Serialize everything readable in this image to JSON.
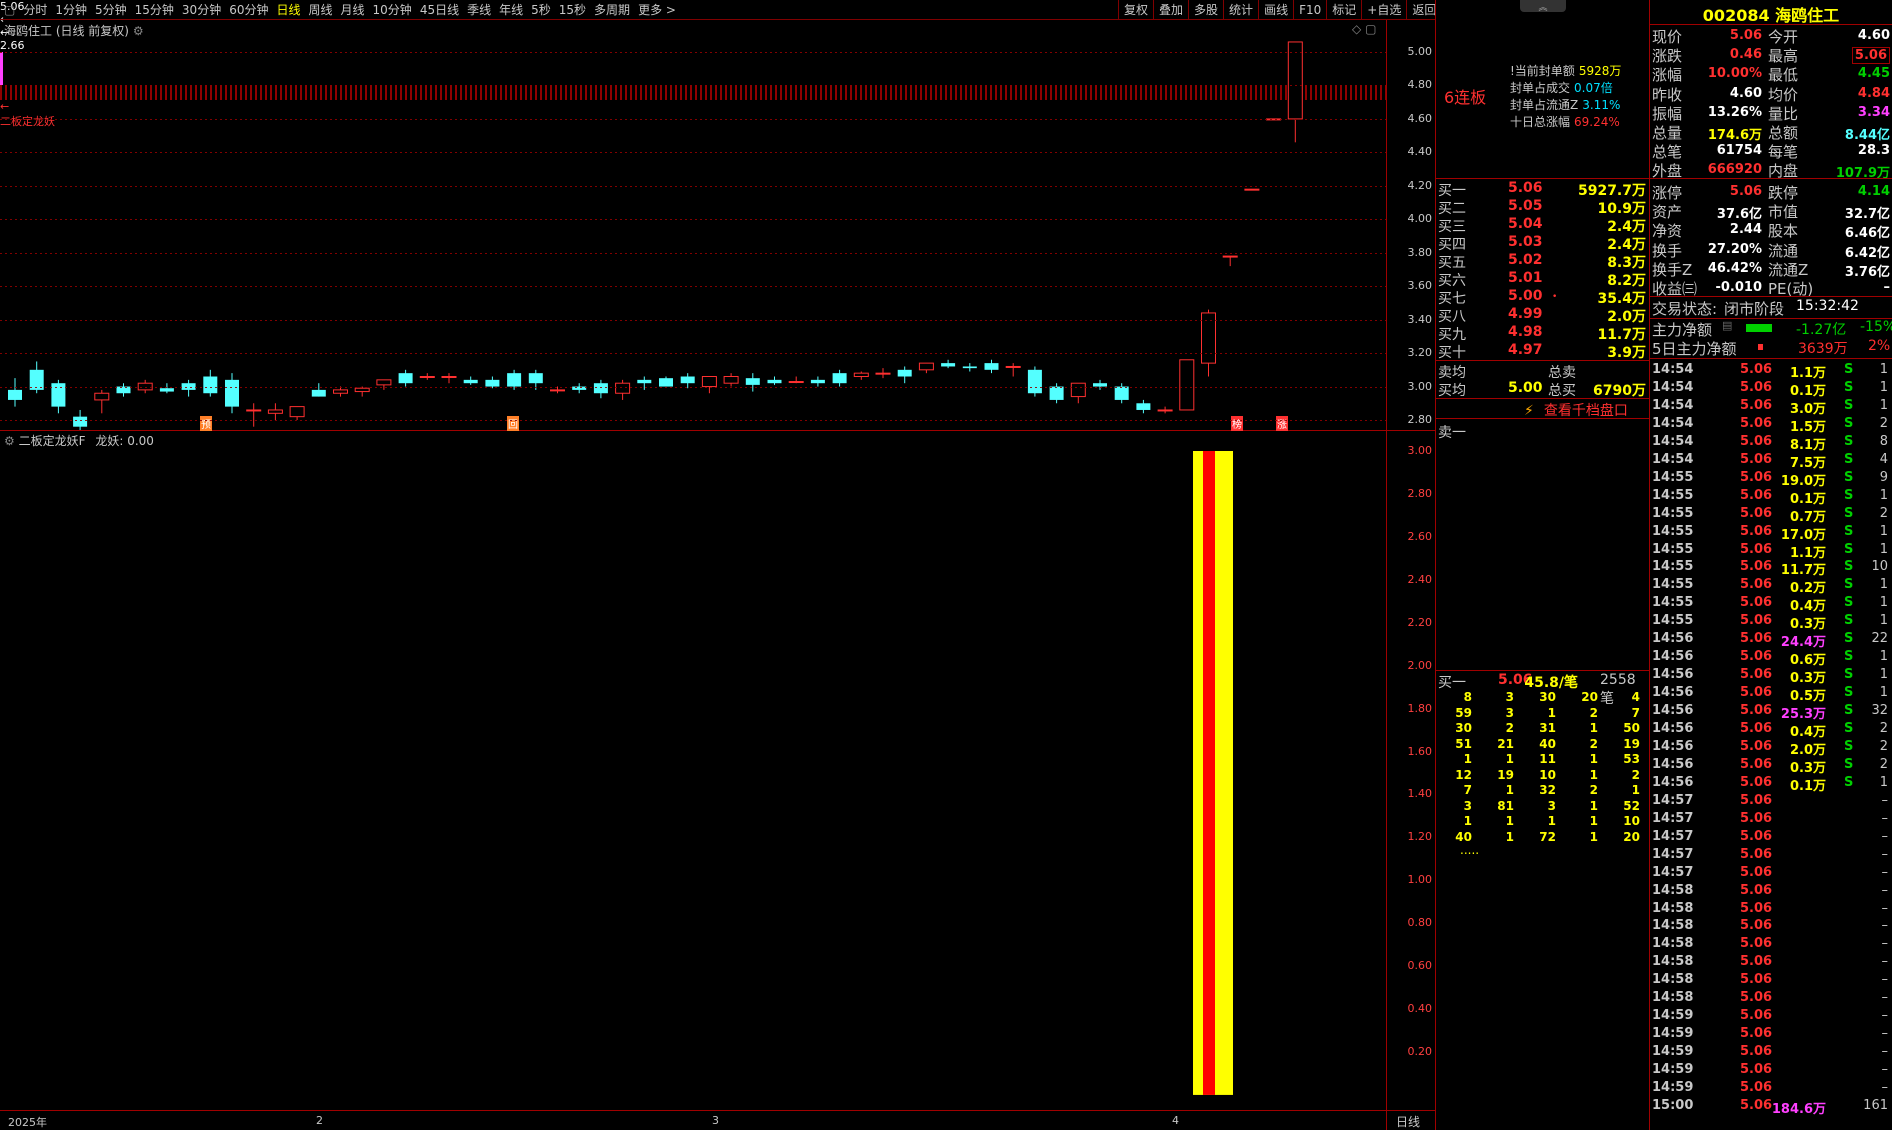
{
  "toolbar": {
    "left": [
      "分时",
      "1分钟",
      "5分钟",
      "15分钟",
      "30分钟",
      "60分钟",
      "日线",
      "周线",
      "月线",
      "10分钟",
      "45日线",
      "季线",
      "年线",
      "5秒",
      "15秒",
      "多周期",
      "更多 >"
    ],
    "active": "日线",
    "right": [
      "复权",
      "叠加",
      "多股",
      "统计",
      "画线",
      "F10",
      "标记",
      "+自选",
      "返回"
    ]
  },
  "chart": {
    "title": "海鸥住工 (日线 前复权)",
    "y_labels": [
      "5.00",
      "4.80",
      "4.60",
      "4.40",
      "4.20",
      "4.00",
      "3.80",
      "3.60",
      "3.40",
      "3.20",
      "3.00",
      "2.80"
    ],
    "high_label": "5.06",
    "low_label": "2.66",
    "markers": [
      "预",
      "回",
      "榜",
      "涨"
    ],
    "x_labels": [
      "2025年",
      "2",
      "3",
      "4"
    ],
    "period": "日线"
  },
  "chart_data": {
    "type": "candlestick",
    "ohlc": [
      [
        2.98,
        3.05,
        2.88,
        2.92
      ],
      [
        3.1,
        3.15,
        2.96,
        2.98
      ],
      [
        3.02,
        3.04,
        2.84,
        2.88
      ],
      [
        2.82,
        2.86,
        2.66,
        2.76
      ],
      [
        2.92,
        2.98,
        2.84,
        2.96
      ],
      [
        3.0,
        3.02,
        2.94,
        2.96
      ],
      [
        2.98,
        3.04,
        2.96,
        3.02
      ],
      [
        2.99,
        3.02,
        2.96,
        2.97
      ],
      [
        3.02,
        3.04,
        2.94,
        2.98
      ],
      [
        3.06,
        3.1,
        2.94,
        2.96
      ],
      [
        3.04,
        3.08,
        2.84,
        2.88
      ],
      [
        2.86,
        2.9,
        2.76,
        2.86
      ],
      [
        2.84,
        2.9,
        2.8,
        2.86
      ],
      [
        2.82,
        2.88,
        2.8,
        2.88
      ],
      [
        2.98,
        3.02,
        2.94,
        2.94
      ],
      [
        2.96,
        3.0,
        2.94,
        2.98
      ],
      [
        2.97,
        3.0,
        2.94,
        2.99
      ],
      [
        3.01,
        3.04,
        2.98,
        3.04
      ],
      [
        3.08,
        3.1,
        3.0,
        3.02
      ],
      [
        3.06,
        3.08,
        3.04,
        3.06
      ],
      [
        3.06,
        3.08,
        3.02,
        3.06
      ],
      [
        3.04,
        3.06,
        3.01,
        3.02
      ],
      [
        3.04,
        3.06,
        2.99,
        3.0
      ],
      [
        3.08,
        3.1,
        2.98,
        3.0
      ],
      [
        3.08,
        3.1,
        2.98,
        3.02
      ],
      [
        2.98,
        3.0,
        2.96,
        2.98
      ],
      [
        3.0,
        3.02,
        2.96,
        2.98
      ],
      [
        3.02,
        3.04,
        2.93,
        2.96
      ],
      [
        2.96,
        3.04,
        2.92,
        3.02
      ],
      [
        3.04,
        3.06,
        2.98,
        3.02
      ],
      [
        3.05,
        3.06,
        3.0,
        3.0
      ],
      [
        3.06,
        3.08,
        2.99,
        3.02
      ],
      [
        3.0,
        3.06,
        2.96,
        3.06
      ],
      [
        3.02,
        3.08,
        3.0,
        3.06
      ],
      [
        3.05,
        3.08,
        2.97,
        3.01
      ],
      [
        3.04,
        3.06,
        3.01,
        3.02
      ],
      [
        3.03,
        3.06,
        3.02,
        3.03
      ],
      [
        3.04,
        3.06,
        3.0,
        3.02
      ],
      [
        3.08,
        3.1,
        3.0,
        3.02
      ],
      [
        3.06,
        3.09,
        3.04,
        3.08
      ],
      [
        3.08,
        3.11,
        3.05,
        3.08
      ],
      [
        3.1,
        3.12,
        3.02,
        3.06
      ],
      [
        3.1,
        3.14,
        3.08,
        3.14
      ],
      [
        3.14,
        3.16,
        3.11,
        3.12
      ],
      [
        3.12,
        3.14,
        3.09,
        3.11
      ],
      [
        3.14,
        3.16,
        3.08,
        3.1
      ],
      [
        3.12,
        3.14,
        3.06,
        3.12
      ],
      [
        3.1,
        3.12,
        2.94,
        2.96
      ],
      [
        3.0,
        3.02,
        2.9,
        2.92
      ],
      [
        2.94,
        3.02,
        2.9,
        3.02
      ],
      [
        3.02,
        3.04,
        2.98,
        3.0
      ],
      [
        3.0,
        3.02,
        2.9,
        2.92
      ],
      [
        2.9,
        2.92,
        2.84,
        2.86
      ],
      [
        2.86,
        2.88,
        2.84,
        2.86
      ],
      [
        2.86,
        3.16,
        2.86,
        3.16
      ],
      [
        3.14,
        3.46,
        3.06,
        3.44
      ],
      [
        3.78,
        3.78,
        3.72,
        3.78
      ],
      [
        4.18,
        4.18,
        4.18,
        4.18
      ],
      [
        4.6,
        4.6,
        4.6,
        4.6
      ],
      [
        4.6,
        5.06,
        4.46,
        5.06
      ]
    ],
    "ylim": [
      2.7,
      5.1
    ],
    "indicator": {
      "name": "二板定龙妖F",
      "series": "龙妖",
      "value": "0.00",
      "bar_value": 3.0,
      "ylim": [
        0,
        3.1
      ],
      "y_labels": [
        "3.00",
        "2.80",
        "2.60",
        "2.40",
        "2.20",
        "2.00",
        "1.80",
        "1.60",
        "1.40",
        "1.20",
        "1.00",
        "0.80",
        "0.60",
        "0.40",
        "0.20"
      ],
      "label": "二板定龙妖"
    }
  },
  "seal": {
    "lianban": "6连板",
    "rows": [
      {
        "k": "!当前封单额",
        "v": "5928万",
        "c": "#ffff00"
      },
      {
        "k": "封单占成交",
        "v": "0.07倍",
        "c": "#00e0ff"
      },
      {
        "k": "封单占流通Z",
        "v": "3.11%",
        "c": "#00e0ff"
      },
      {
        "k": "十日总涨幅",
        "v": "69.24%",
        "c": "#ff3030"
      }
    ]
  },
  "orderbook": {
    "buys": [
      {
        "l": "买一",
        "p": "5.06",
        "v": "5927.7万"
      },
      {
        "l": "买二",
        "p": "5.05",
        "v": "10.9万"
      },
      {
        "l": "买三",
        "p": "5.04",
        "v": "2.4万"
      },
      {
        "l": "买四",
        "p": "5.03",
        "v": "2.4万"
      },
      {
        "l": "买五",
        "p": "5.02",
        "v": "8.3万"
      },
      {
        "l": "买六",
        "p": "5.01",
        "v": "8.2万"
      },
      {
        "l": "买七",
        "p": "5.00",
        "v": "35.4万"
      },
      {
        "l": "买八",
        "p": "4.99",
        "v": "2.0万"
      },
      {
        "l": "买九",
        "p": "4.98",
        "v": "11.7万"
      },
      {
        "l": "买十",
        "p": "4.97",
        "v": "3.9万"
      }
    ],
    "avg_sell_label": "卖均",
    "total_sell_label": "总卖",
    "avg_buy_label": "买均",
    "avg_buy": "5.00",
    "total_buy_label": "总买",
    "total_buy": "6790万",
    "link": "查看千档盘口",
    "sell1": "卖一",
    "queue": {
      "label": "买一",
      "price": "5.06",
      "per": "45.8/笔",
      "count": "2558笔",
      "rows": [
        [
          "8",
          "3",
          "30",
          "20",
          "4"
        ],
        [
          "59",
          "3",
          "1",
          "2",
          "7"
        ],
        [
          "30",
          "2",
          "31",
          "1",
          "50"
        ],
        [
          "51",
          "21",
          "40",
          "2",
          "19"
        ],
        [
          "1",
          "1",
          "11",
          "1",
          "53"
        ],
        [
          "12",
          "19",
          "10",
          "1",
          "2"
        ],
        [
          "7",
          "1",
          "32",
          "2",
          "1"
        ],
        [
          "3",
          "81",
          "3",
          "1",
          "52"
        ],
        [
          "1",
          "1",
          "1",
          "1",
          "10"
        ],
        [
          "40",
          "1",
          "72",
          "1",
          "20"
        ]
      ],
      "more": "....."
    }
  },
  "quote": {
    "code": "002084",
    "name": "海鸥住工",
    "rows": [
      [
        "现价",
        "5.06",
        "今开",
        "4.60"
      ],
      [
        "涨跌",
        "0.46",
        "最高",
        "5.06"
      ],
      [
        "涨幅",
        "10.00%",
        "最低",
        "4.45"
      ],
      [
        "昨收",
        "4.60",
        "均价",
        "4.84"
      ],
      [
        "振幅",
        "13.26%",
        "量比",
        "3.34"
      ],
      [
        "总量",
        "174.6万",
        "总额",
        "8.44亿"
      ],
      [
        "总笔",
        "61754",
        "每笔",
        "28.3"
      ],
      [
        "外盘",
        "666920",
        "内盘",
        "107.9万"
      ],
      [
        "涨停",
        "5.06",
        "跌停",
        "4.14"
      ],
      [
        "资产",
        "37.6亿",
        "市值",
        "32.7亿"
      ],
      [
        "净资",
        "2.44",
        "股本",
        "6.46亿"
      ],
      [
        "换手",
        "27.20%",
        "流通",
        "6.42亿"
      ],
      [
        "换手Z",
        "46.42%",
        "流通Z",
        "3.76亿"
      ],
      [
        "收益㈢",
        "-0.010",
        "PE(动)",
        "–"
      ]
    ],
    "status_label": "交易状态:",
    "status": "闭市阶段",
    "time": "15:32:42",
    "main_flow_label": "主力净额",
    "main_flow": "-1.27亿",
    "main_flow_pct": "-15%",
    "flow5_label": "5日主力净额",
    "flow5": "3639万",
    "flow5_pct": "2%"
  },
  "ticks": [
    [
      "14:54",
      "5.06",
      "1.1万",
      "S",
      "1"
    ],
    [
      "14:54",
      "5.06",
      "0.1万",
      "S",
      "1"
    ],
    [
      "14:54",
      "5.06",
      "3.0万",
      "S",
      "1"
    ],
    [
      "14:54",
      "5.06",
      "1.5万",
      "S",
      "2"
    ],
    [
      "14:54",
      "5.06",
      "8.1万",
      "S",
      "8"
    ],
    [
      "14:54",
      "5.06",
      "7.5万",
      "S",
      "4"
    ],
    [
      "14:55",
      "5.06",
      "19.0万",
      "S",
      "9"
    ],
    [
      "14:55",
      "5.06",
      "0.1万",
      "S",
      "1"
    ],
    [
      "14:55",
      "5.06",
      "0.7万",
      "S",
      "2"
    ],
    [
      "14:55",
      "5.06",
      "17.0万",
      "S",
      "1"
    ],
    [
      "14:55",
      "5.06",
      "1.1万",
      "S",
      "1"
    ],
    [
      "14:55",
      "5.06",
      "11.7万",
      "S",
      "10"
    ],
    [
      "14:55",
      "5.06",
      "0.2万",
      "S",
      "1"
    ],
    [
      "14:55",
      "5.06",
      "0.4万",
      "S",
      "1"
    ],
    [
      "14:55",
      "5.06",
      "0.3万",
      "S",
      "1"
    ],
    [
      "14:56",
      "5.06",
      "24.4万",
      "S",
      "22"
    ],
    [
      "14:56",
      "5.06",
      "0.6万",
      "S",
      "1"
    ],
    [
      "14:56",
      "5.06",
      "0.3万",
      "S",
      "1"
    ],
    [
      "14:56",
      "5.06",
      "0.5万",
      "S",
      "1"
    ],
    [
      "14:56",
      "5.06",
      "25.3万",
      "S",
      "32"
    ],
    [
      "14:56",
      "5.06",
      "0.4万",
      "S",
      "2"
    ],
    [
      "14:56",
      "5.06",
      "2.0万",
      "S",
      "2"
    ],
    [
      "14:56",
      "5.06",
      "0.3万",
      "S",
      "2"
    ],
    [
      "14:56",
      "5.06",
      "0.1万",
      "S",
      "1"
    ],
    [
      "14:57",
      "5.06",
      "",
      "",
      "–"
    ],
    [
      "14:57",
      "5.06",
      "",
      "",
      "–"
    ],
    [
      "14:57",
      "5.06",
      "",
      "",
      "–"
    ],
    [
      "14:57",
      "5.06",
      "",
      "",
      "–"
    ],
    [
      "14:57",
      "5.06",
      "",
      "",
      "–"
    ],
    [
      "14:58",
      "5.06",
      "",
      "",
      "–"
    ],
    [
      "14:58",
      "5.06",
      "",
      "",
      "–"
    ],
    [
      "14:58",
      "5.06",
      "",
      "",
      "–"
    ],
    [
      "14:58",
      "5.06",
      "",
      "",
      "–"
    ],
    [
      "14:58",
      "5.06",
      "",
      "",
      "–"
    ],
    [
      "14:58",
      "5.06",
      "",
      "",
      "–"
    ],
    [
      "14:58",
      "5.06",
      "",
      "",
      "–"
    ],
    [
      "14:59",
      "5.06",
      "",
      "",
      "–"
    ],
    [
      "14:59",
      "5.06",
      "",
      "",
      "–"
    ],
    [
      "14:59",
      "5.06",
      "",
      "",
      "–"
    ],
    [
      "14:59",
      "5.06",
      "",
      "",
      "–"
    ],
    [
      "14:59",
      "5.06",
      "",
      "",
      "–"
    ],
    [
      "15:00",
      "5.06",
      "184.6万",
      "",
      "161"
    ]
  ],
  "colors": {
    "up": "#ff3030",
    "down": "#54ffff",
    "grid": "#a00000",
    "yellow": "#ffff00"
  }
}
